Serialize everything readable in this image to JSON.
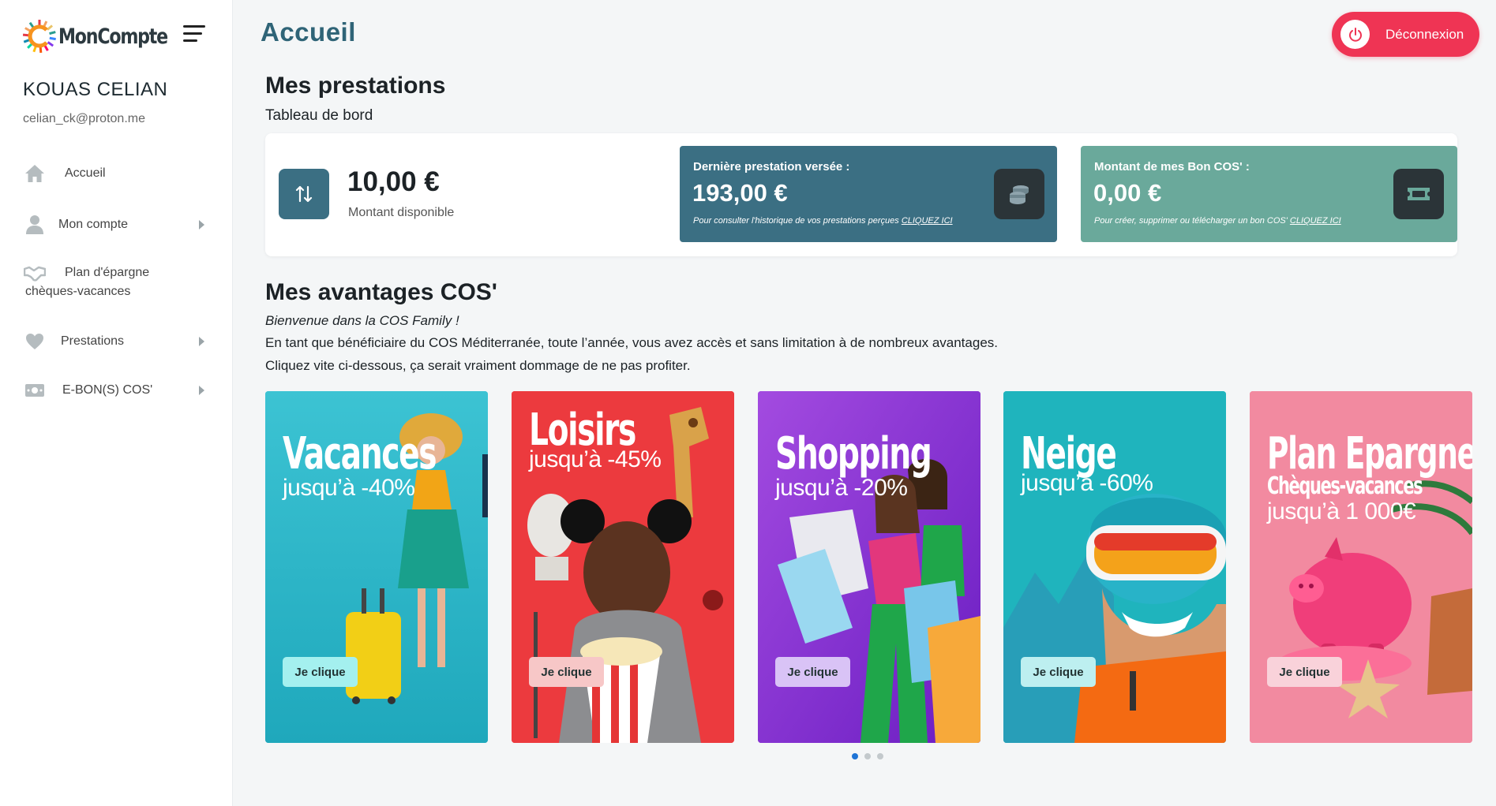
{
  "app": {
    "logo_text": "MonCompte",
    "page_title": "Accueil",
    "logout_label": "Déconnexion"
  },
  "user": {
    "name": "KOUAS CELIAN",
    "email": "celian_ck@proton.me"
  },
  "sidebar": {
    "items": [
      {
        "label": "Accueil",
        "icon": "home-icon",
        "has_submenu": false
      },
      {
        "label": "Mon compte",
        "icon": "user-icon",
        "has_submenu": true
      },
      {
        "label_line1": "Plan d'épargne",
        "label_line2": "chèques-vacances",
        "icon": "handshake-icon",
        "has_submenu": false
      },
      {
        "label": "Prestations",
        "icon": "heart-icon",
        "has_submenu": true
      },
      {
        "label": "E-BON(S) COS'",
        "icon": "banknote-icon",
        "has_submenu": true
      }
    ]
  },
  "prestations": {
    "title": "Mes prestations",
    "subtitle": "Tableau de bord",
    "available_amount": "10,00 €",
    "available_label": "Montant disponible",
    "last_payment": {
      "title": "Dernière prestation versée :",
      "value": "193,00 €",
      "note": "Pour consulter l'historique de vos prestations perçues",
      "link": "CLIQUEZ ICI",
      "color": "#3b6f83"
    },
    "bon_cos": {
      "title": "Montant de mes Bon COS' :",
      "value": "0,00 €",
      "note": "Pour créer, supprimer ou télécharger un bon COS'",
      "link": "CLIQUEZ ICI",
      "color": "#6aa99b"
    }
  },
  "avantages": {
    "title": "Mes avantages COS'",
    "welcome": "Bienvenue dans la COS Family !",
    "line1": "En tant que bénéficiaire du COS Méditerranée, toute l’année, vous avez accès et sans limitation à de nombreux avantages.",
    "line2": "Cliquez vite ci-dessous, ça serait vraiment dommage de ne pas profiter.",
    "cards": [
      {
        "title": "Vacances",
        "subtitle": "jusqu’à -40%",
        "button": "Je clique",
        "bg": "#29b5c7"
      },
      {
        "title": "Loisirs",
        "subtitle": "jusqu’à -45%",
        "button": "Je clique",
        "bg": "#ee3b3b"
      },
      {
        "title": "Shopping",
        "subtitle": "jusqu’à -20%",
        "button": "Je clique",
        "bg": "#8a2fd6"
      },
      {
        "title": "Neige",
        "subtitle": "jusqu’à -60%",
        "button": "Je clique",
        "bg": "#22b6bd"
      },
      {
        "title": "Plan Epargne",
        "title2": "Chèques-vacances",
        "subtitle": "jusqu’à 1 000€",
        "button": "Je clique",
        "bg": "#f07a92"
      }
    ],
    "carousel_pages": 3,
    "carousel_active": 1
  }
}
